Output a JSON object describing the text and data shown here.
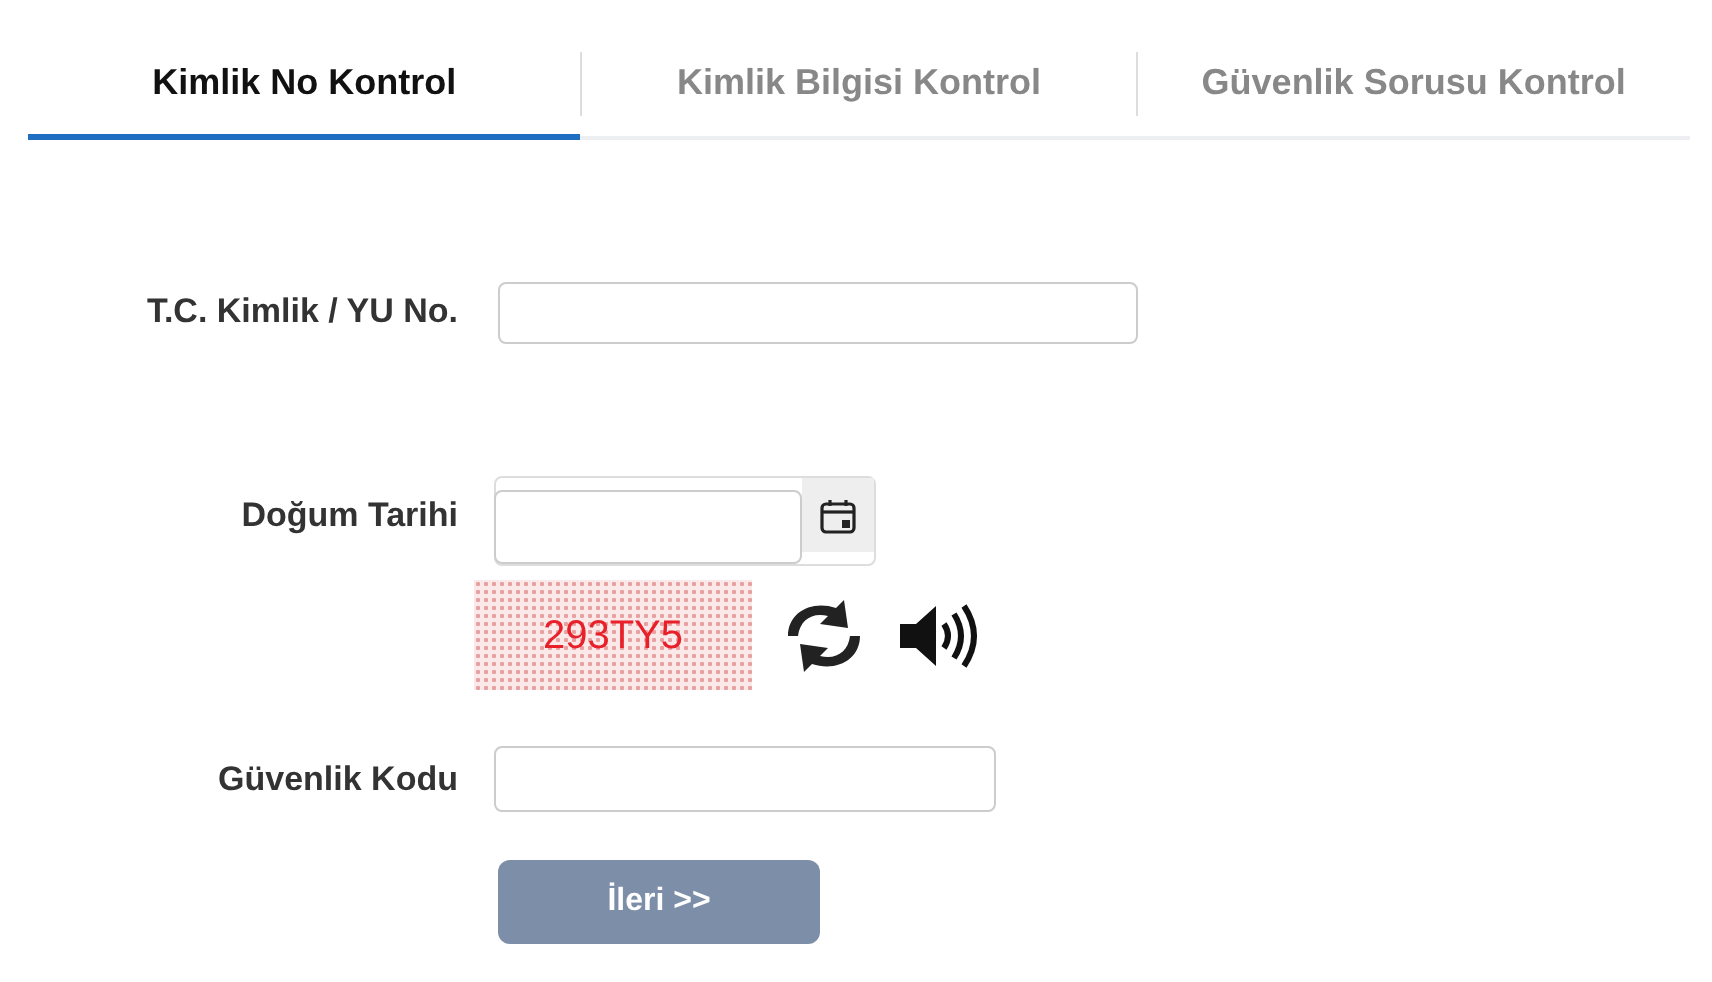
{
  "tabs": [
    {
      "label": "Kimlik No Kontrol",
      "selected": true
    },
    {
      "label": "Kimlik Bilgisi Kontrol",
      "selected": false
    },
    {
      "label": "Güvenlik Sorusu Kontrol",
      "selected": false
    }
  ],
  "form": {
    "id_label": "T.C. Kimlik / YU No.",
    "birth_label": "Doğum Tarihi",
    "captcha_text": "293TY5",
    "security_label": "Güvenlik Kodu",
    "submit": "İleri >>"
  }
}
